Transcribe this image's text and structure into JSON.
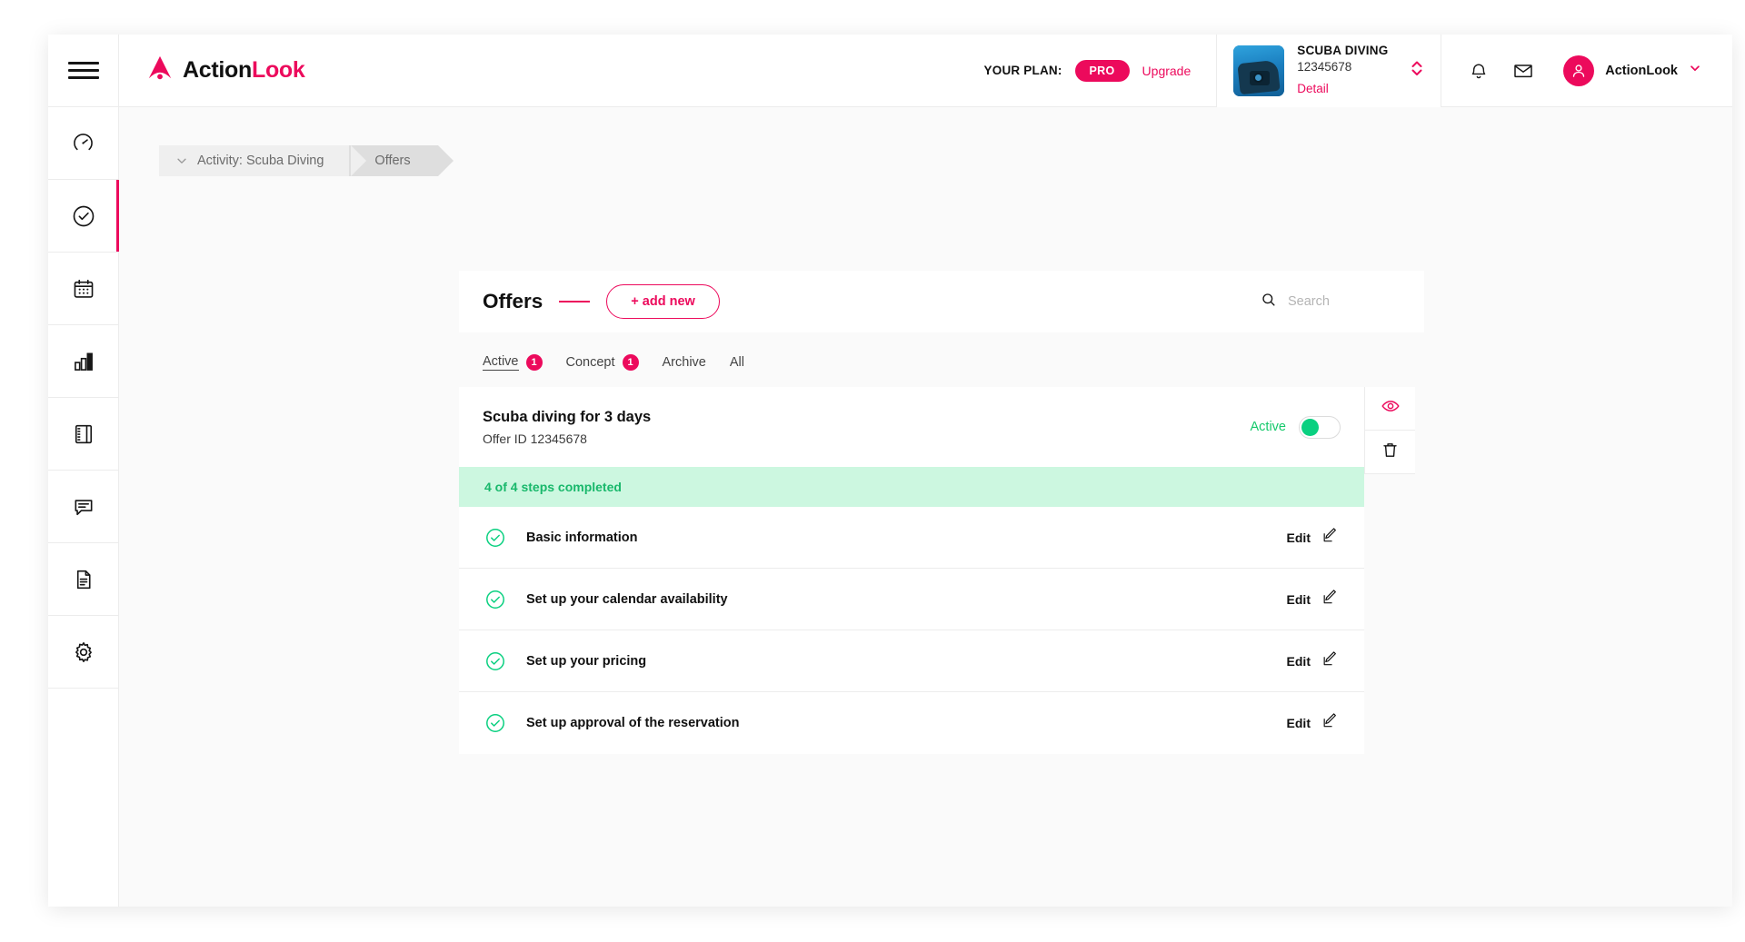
{
  "brand": {
    "name_dark": "Action",
    "name_pink": "Look"
  },
  "topbar": {
    "plan_label": "YOUR PLAN:",
    "plan_badge": "PRO",
    "upgrade_label": "Upgrade",
    "account": {
      "name": "SCUBA DIVING",
      "id": "12345678",
      "detail_link": "Detail"
    },
    "user_name": "ActionLook",
    "icons": {
      "bell": "bell-icon",
      "mail": "mail-icon",
      "avatar": "user-avatar-icon",
      "caret": "chevron-down-icon"
    }
  },
  "sidebar": {
    "menu_icon": "hamburger-icon",
    "items": [
      {
        "icon": "dashboard-gauge-icon",
        "active": false
      },
      {
        "icon": "check-circle-icon",
        "active": true
      },
      {
        "icon": "calendar-icon",
        "active": false
      },
      {
        "icon": "bar-chart-icon",
        "active": false
      },
      {
        "icon": "notebook-icon",
        "active": false
      },
      {
        "icon": "chat-bubble-icon",
        "active": false
      },
      {
        "icon": "document-icon",
        "active": false
      },
      {
        "icon": "gear-icon",
        "active": false
      }
    ]
  },
  "breadcrumb": {
    "items": [
      {
        "label": "Activity: Scuba Diving"
      },
      {
        "label": "Offers"
      }
    ]
  },
  "offers": {
    "title": "Offers",
    "add_new_label": "+ add new",
    "search_placeholder": "Search",
    "search_value": "",
    "tabs": [
      {
        "label": "Active",
        "badge": "1",
        "selected": true
      },
      {
        "label": "Concept",
        "badge": "1",
        "selected": false
      },
      {
        "label": "Archive",
        "badge": "",
        "selected": false
      },
      {
        "label": "All",
        "badge": "",
        "selected": false
      }
    ],
    "card": {
      "name": "Scuba diving for 3 days",
      "offer_id": "Offer ID 12345678",
      "status_label": "Active",
      "status_on": true,
      "progress_text": "4 of 4 steps completed",
      "steps": [
        {
          "label": "Basic information",
          "completed": true,
          "edit_label": "Edit"
        },
        {
          "label": "Set up your calendar availability",
          "completed": true,
          "edit_label": "Edit"
        },
        {
          "label": "Set up your pricing",
          "completed": true,
          "edit_label": "Edit"
        },
        {
          "label": "Set up approval of the reservation",
          "completed": true,
          "edit_label": "Edit"
        }
      ],
      "actions": [
        {
          "icon": "eye-icon",
          "color": "#ec0a5c"
        },
        {
          "icon": "trash-icon",
          "color": "#111111"
        }
      ]
    }
  },
  "colors": {
    "accent_pink": "#ec0a5c",
    "success_green": "#0ad080",
    "progress_bg": "#ccf7e0"
  }
}
